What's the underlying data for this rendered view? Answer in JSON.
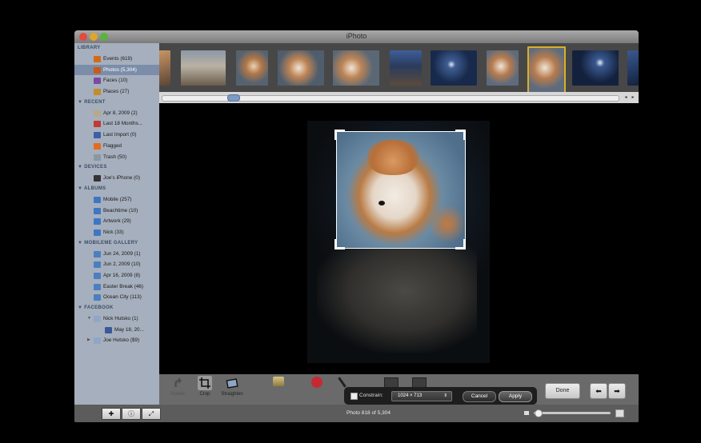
{
  "window": {
    "title": "iPhoto"
  },
  "sidebar": {
    "library": {
      "header": "LIBRARY",
      "items": [
        {
          "label": "Events (619)",
          "icon": "events-icon",
          "color": "#d26b18"
        },
        {
          "label": "Photos (5,304)",
          "icon": "photos-icon",
          "color": "#c85a1a",
          "selected": true
        },
        {
          "label": "Faces (10)",
          "icon": "faces-icon",
          "color": "#7b4aa2"
        },
        {
          "label": "Places (27)",
          "icon": "places-icon",
          "color": "#c48c2a"
        }
      ]
    },
    "recent": {
      "header": "RECENT",
      "items": [
        {
          "label": "Apr 8, 2009 (2)",
          "icon": "event-icon",
          "color": "#b7a98c"
        },
        {
          "label": "Last 18 Months...",
          "icon": "calendar-icon",
          "color": "#c23a34"
        },
        {
          "label": "Last Import (0)",
          "icon": "import-icon",
          "color": "#3f5ea6"
        },
        {
          "label": "Flagged",
          "icon": "flag-icon",
          "color": "#e36d1c"
        },
        {
          "label": "Trash (50)",
          "icon": "trash-icon",
          "color": "#8d97a4"
        }
      ]
    },
    "devices": {
      "header": "DEVICES",
      "items": [
        {
          "label": "Joe's iPhone (0)",
          "icon": "iphone-icon",
          "color": "#333333"
        }
      ]
    },
    "albums": {
      "header": "ALBUMS",
      "items": [
        {
          "label": "Mobile (257)",
          "icon": "album-icon",
          "color": "#3f76c4"
        },
        {
          "label": "Beachtime (10)",
          "icon": "album-icon",
          "color": "#3f76c4"
        },
        {
          "label": "Artwork (29)",
          "icon": "album-icon",
          "color": "#3f76c4"
        },
        {
          "label": "Nick (33)",
          "icon": "album-icon",
          "color": "#3f76c4"
        }
      ]
    },
    "mobileme": {
      "header": "MOBILEME GALLERY",
      "items": [
        {
          "label": "Jun 24, 2009 (1)",
          "icon": "gallery-icon",
          "color": "#4b7fc0"
        },
        {
          "label": "Jun 2, 2009 (10)",
          "icon": "gallery-icon",
          "color": "#4b7fc0"
        },
        {
          "label": "Apr 16, 2009 (8)",
          "icon": "gallery-icon",
          "color": "#4b7fc0"
        },
        {
          "label": "Easter Break (46)",
          "icon": "gallery-icon",
          "color": "#4b7fc0"
        },
        {
          "label": "Ocean City (113)",
          "icon": "gallery-icon",
          "color": "#4b7fc0"
        }
      ]
    },
    "facebook": {
      "header": "FACEBOOK",
      "items": [
        {
          "label": "Nick Hutsko (1)",
          "icon": "facebook-folder-icon",
          "color": "#8fa6c8",
          "expanded": true
        },
        {
          "label": "May 18, 20...",
          "icon": "facebook-icon",
          "color": "#3b5998"
        },
        {
          "label": "Joe Hutsko ($9)",
          "icon": "facebook-folder-icon",
          "color": "#8fa6c8",
          "expanded": false
        }
      ]
    }
  },
  "toolbar": {
    "rotate_label": "Rotate",
    "crop_label": "Crop",
    "straighten_label": "Straighten",
    "constrain_label": "Constrain:",
    "constrain_value": "1024 × 713",
    "cancel_label": "Cancel",
    "apply_label": "Apply",
    "done_label": "Done"
  },
  "status": {
    "text": "Photo 818 of 5,304"
  },
  "colors": {
    "accent_selected": "#7c8da9",
    "sidebar_bg": "#a6afbd",
    "thumb_selected_border": "#d8b02a"
  }
}
